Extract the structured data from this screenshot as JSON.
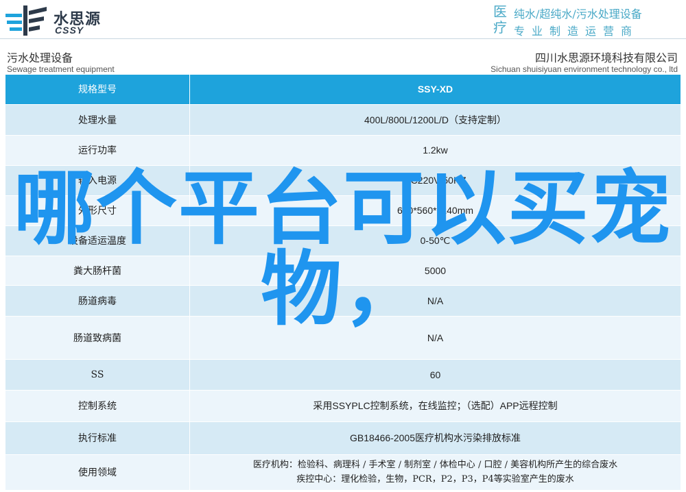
{
  "brand": {
    "name_cn": "水思源",
    "name_en": "CSSY",
    "colors": {
      "primary": "#1ea3dc",
      "header_text": "#4aa9c7",
      "overlay": "#1f95ef"
    }
  },
  "header_right": {
    "big": "医疗",
    "line1": "纯水/超纯水/污水处理设备",
    "line2": "专业制造运营商"
  },
  "subheader": {
    "left_cn": "污水处理设备",
    "left_en": "Sewage treatment equipment",
    "right_cn": "四川水思源环境科技有限公司",
    "right_en": "Sichuan shuisiyuan environment technology co., ltd"
  },
  "table": {
    "header": {
      "key": "规格型号",
      "value": "SSY-XD"
    },
    "rows": [
      {
        "key": "处理水量",
        "value": "400L/800L/1200L/D（支持定制）"
      },
      {
        "key": "运行功率",
        "value": "1.2kw"
      },
      {
        "key": "输入电源",
        "value": "AC220V/50HZ"
      },
      {
        "key": "外形尺寸",
        "value": "680*560*1140mm"
      },
      {
        "key": "设备适运温度",
        "value": "0-50℃"
      },
      {
        "key": "粪大肠杆菌",
        "value": "5000"
      },
      {
        "key": "肠道病毒",
        "value": "N/A"
      },
      {
        "key": "肠道致病菌",
        "value": "N/A"
      },
      {
        "key": "SS",
        "value": "60"
      },
      {
        "key": "控制系统",
        "value": "采用SSYPLC控制系统，在线监控；（选配）APP远程控制"
      },
      {
        "key": "执行标准",
        "value": "GB18466-2005医疗机构水污染排放标准"
      }
    ],
    "usage": {
      "key": "使用领域",
      "line1": "医疗机构：检验科、病理科 / 手术室 / 制剂室 / 体检中心 / 口腔 / 美容机构所产生的综合废水",
      "line2": "疾控中心：理化检验，生物，PCR，P2，P3，P4等实验室产生的废水"
    }
  },
  "overlay": {
    "line1": "哪个平台可以买宠",
    "line2": "物，"
  }
}
